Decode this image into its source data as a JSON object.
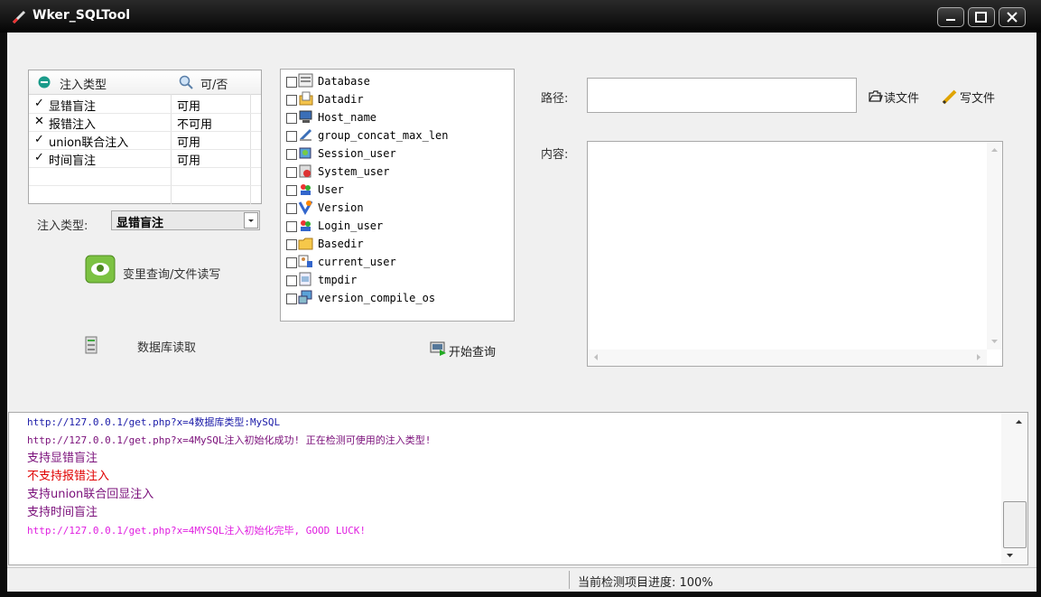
{
  "window": {
    "title": "Wker_SQLTool"
  },
  "inject_table": {
    "header_type": "注入类型",
    "header_avail": "可/否",
    "rows": [
      {
        "mark": "✓",
        "name": "显错盲注",
        "avail": "可用"
      },
      {
        "mark": "✕",
        "name": "报错注入",
        "avail": "不可用"
      },
      {
        "mark": "✓",
        "name": "union联合注入",
        "avail": "可用"
      },
      {
        "mark": "✓",
        "name": "时间盲注",
        "avail": "可用"
      }
    ]
  },
  "inject_select": {
    "label": "注入类型:",
    "value": "显错盲注"
  },
  "buttons": {
    "var_query": "变里查询/文件读写",
    "db_read": "数据库读取",
    "start_query": "开始查询",
    "read_file": "读文件",
    "write_file": "写文件"
  },
  "checklist": [
    {
      "label": "Database",
      "icon": "database-icon"
    },
    {
      "label": "Datadir",
      "icon": "folder-doc-icon"
    },
    {
      "label": "Host_name",
      "icon": "computer-icon"
    },
    {
      "label": "group_concat_max_len",
      "icon": "pen-icon"
    },
    {
      "label": "Session_user",
      "icon": "session-user-icon"
    },
    {
      "label": "System_user",
      "icon": "system-user-icon"
    },
    {
      "label": "User",
      "icon": "user-icon"
    },
    {
      "label": "Version",
      "icon": "version-icon"
    },
    {
      "label": "Login_user",
      "icon": "login-user-icon"
    },
    {
      "label": "Basedir",
      "icon": "folder-icon"
    },
    {
      "label": "current_user",
      "icon": "current-user-icon"
    },
    {
      "label": "tmpdir",
      "icon": "tmpdir-icon"
    },
    {
      "label": "version_compile_os",
      "icon": "os-icon"
    }
  ],
  "file_panel": {
    "path_label": "路径:",
    "path_value": "",
    "content_label": "内容:"
  },
  "log": [
    {
      "text": "http://127.0.0.1/get.php?x=4数据库类型:MySQL",
      "color": "#1a1aa8"
    },
    {
      "text": "http://127.0.0.1/get.php?x=4MySQL注入初始化成功! 正在检测可使用的注入类型!",
      "color": "#7a0f7a"
    },
    {
      "text": "支持显错盲注",
      "color": "#7a0f7a"
    },
    {
      "text": "不支持报错注入",
      "color": "#e00000"
    },
    {
      "text": "支持union联合回显注入",
      "color": "#7a0f7a"
    },
    {
      "text": "支持时间盲注",
      "color": "#7a0f7a"
    },
    {
      "text": "http://127.0.0.1/get.php?x=4MYSQL注入初始化完毕, GOOD LUCK!",
      "color": "#e020e0"
    }
  ],
  "status": {
    "progress_text": "当前检测项目进度: 100%"
  }
}
